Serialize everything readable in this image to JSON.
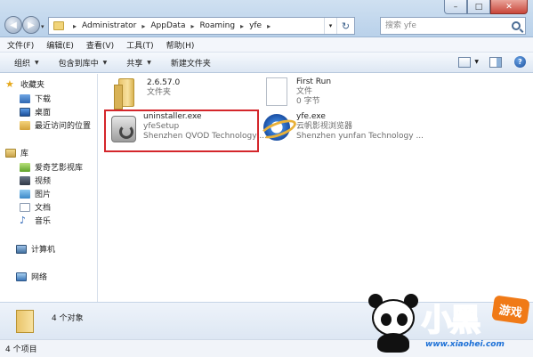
{
  "window": {
    "minimize": "–",
    "maximize": "□",
    "close": "✕"
  },
  "nav": {
    "back": "◀",
    "forward": "▶",
    "dropdown": "▾"
  },
  "address": {
    "crumbs": [
      "Administrator",
      "AppData",
      "Roaming",
      "yfe"
    ],
    "separator": "▸",
    "refresh": "↻"
  },
  "search": {
    "placeholder": "搜索 yfe"
  },
  "menubar": {
    "items": [
      "文件(F)",
      "编辑(E)",
      "查看(V)",
      "工具(T)",
      "帮助(H)"
    ]
  },
  "toolbar": {
    "organize": "组织",
    "include_library": "包含到库中",
    "share": "共享",
    "new_folder": "新建文件夹",
    "arrow": "▼",
    "help": "?"
  },
  "navpane": {
    "favorites": {
      "label": "收藏夹",
      "items": [
        "下载",
        "桌面",
        "最近访问的位置"
      ]
    },
    "libraries": {
      "label": "库",
      "items": [
        "爱奇艺影视库",
        "视频",
        "图片",
        "文档",
        "音乐"
      ]
    },
    "computer": "计算机",
    "network": "网络"
  },
  "files": [
    {
      "name": "2.6.57.0",
      "line2": "文件夹",
      "line3": "",
      "icon": "folder-icon"
    },
    {
      "name": "First Run",
      "line2": "文件",
      "line3": "0 字节",
      "icon": "blank-file-icon"
    },
    {
      "name": "uninstaller.exe",
      "line2": "yfeSetup",
      "line3": "Shenzhen QVOD Technology ...",
      "icon": "uninstaller-icon"
    },
    {
      "name": "yfe.exe",
      "line2": "云帆影视浏览器",
      "line3": "Shenzhen yunfan Technology ...",
      "icon": "ie-style-icon"
    }
  ],
  "details": {
    "count": "4 个对象"
  },
  "status": {
    "count": "4 个项目"
  },
  "watermark": {
    "text": "小黑",
    "badge": "游戏",
    "url": "www.xiaohei.com"
  },
  "colors": {
    "highlight": "#d4262b",
    "accent": "#1b6fd6"
  }
}
